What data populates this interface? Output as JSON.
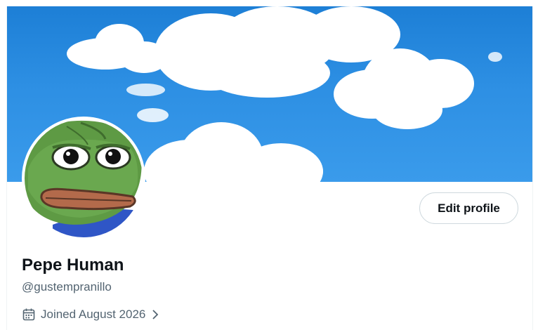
{
  "profile": {
    "display_name": "Pepe Human",
    "handle": "@gustempranillo",
    "joined": "Joined August 2026",
    "edit_button_label": "Edit profile"
  },
  "icons": {
    "calendar": "calendar-icon",
    "chevron": "chevron-right-icon"
  },
  "colors": {
    "text_primary": "#0f1419",
    "text_secondary": "#536471",
    "banner_sky": "#2d8fe3",
    "button_border": "#cfd9de"
  }
}
